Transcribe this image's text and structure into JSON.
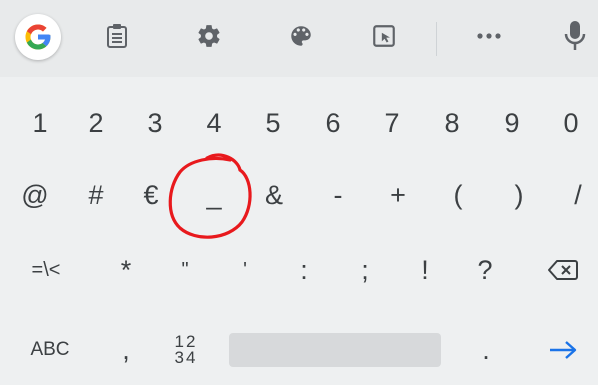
{
  "toolbar": {
    "icons": {
      "google": "google-icon",
      "clipboard": "clipboard-icon",
      "settings": "gear-icon",
      "theme": "palette-icon",
      "select": "text-select-icon",
      "more": "more-horizontal-icon",
      "voice": "microphone-icon"
    },
    "google_letter": "G"
  },
  "rows": {
    "numbers": [
      "1",
      "2",
      "3",
      "4",
      "5",
      "6",
      "7",
      "8",
      "9",
      "0"
    ],
    "symbols": [
      "@",
      "#",
      "€",
      "_",
      "&",
      "-",
      "+",
      "(",
      ")",
      "/"
    ],
    "more_symbols": [
      "=\\<",
      "*",
      "\"",
      "'",
      ":",
      ";",
      "!",
      "?"
    ]
  },
  "bottom": {
    "abc_label": "ABC",
    "comma": ",",
    "numpad_top": "12",
    "numpad_bottom": "34",
    "period": ".",
    "enter_icon": "arrow-right-icon",
    "backspace_icon": "backspace-icon"
  },
  "annotation": {
    "color": "#e8191d",
    "target": "_"
  },
  "colors": {
    "background": "#eef0f1",
    "toolbar": "#e8eaeb",
    "key_text": "#3c4043",
    "enter_blue": "#1a73e8"
  }
}
